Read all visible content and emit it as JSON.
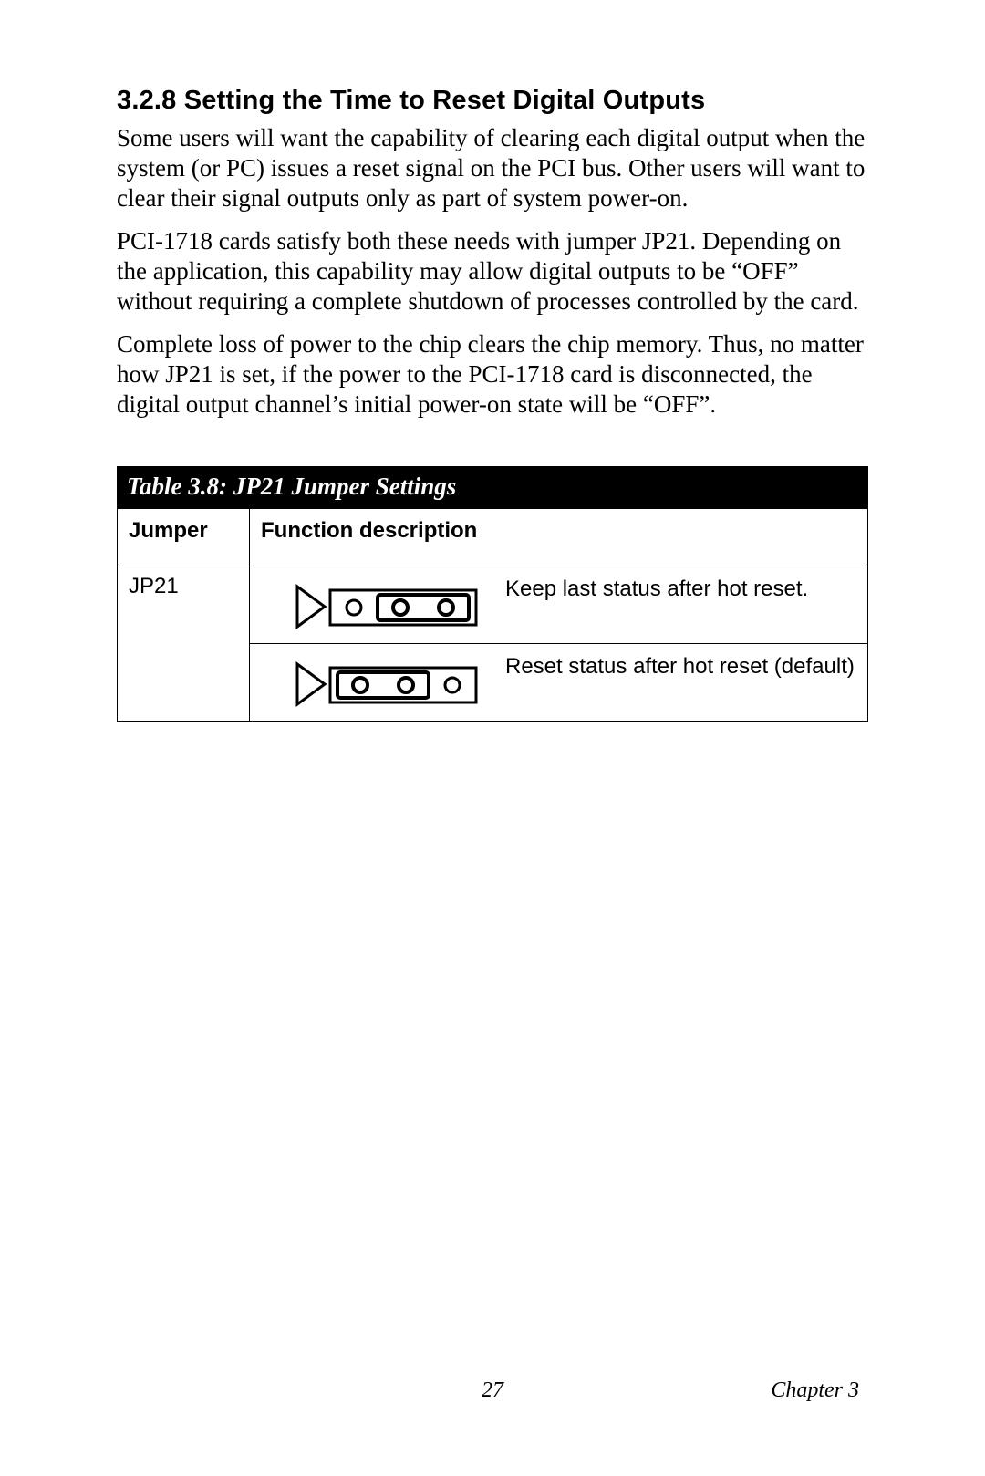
{
  "section": {
    "heading": "3.2.8 Setting the Time to Reset Digital Outputs",
    "para1": "Some users will want the capability of clearing each digital output when the system (or PC) issues a reset signal on the PCI bus. Other users will want to clear their signal outputs only as part of system power-on.",
    "para2": "PCI-1718 cards satisfy both these needs with jumper JP21. Depending on the application, this capability may allow digital outputs to be “OFF” without requiring a complete shutdown of processes controlled by the card.",
    "para3": "Complete loss of power to the chip clears the chip memory. Thus, no matter how JP21 is set, if the power to the PCI-1718 card is disconnected, the digital output channel’s initial power-on state will be “OFF”."
  },
  "table": {
    "title": "Table 3.8: JP21 Jumper Settings",
    "headers": {
      "jumper": "Jumper",
      "func": "Function description"
    },
    "rows": [
      {
        "jumper": "JP21",
        "desc": "Keep last status after hot reset.",
        "jumper_pos": "right"
      },
      {
        "jumper": "",
        "desc": "Reset status after hot reset (default)",
        "jumper_pos": "left"
      }
    ]
  },
  "footer": {
    "page": "27",
    "chapter": "Chapter 3"
  }
}
